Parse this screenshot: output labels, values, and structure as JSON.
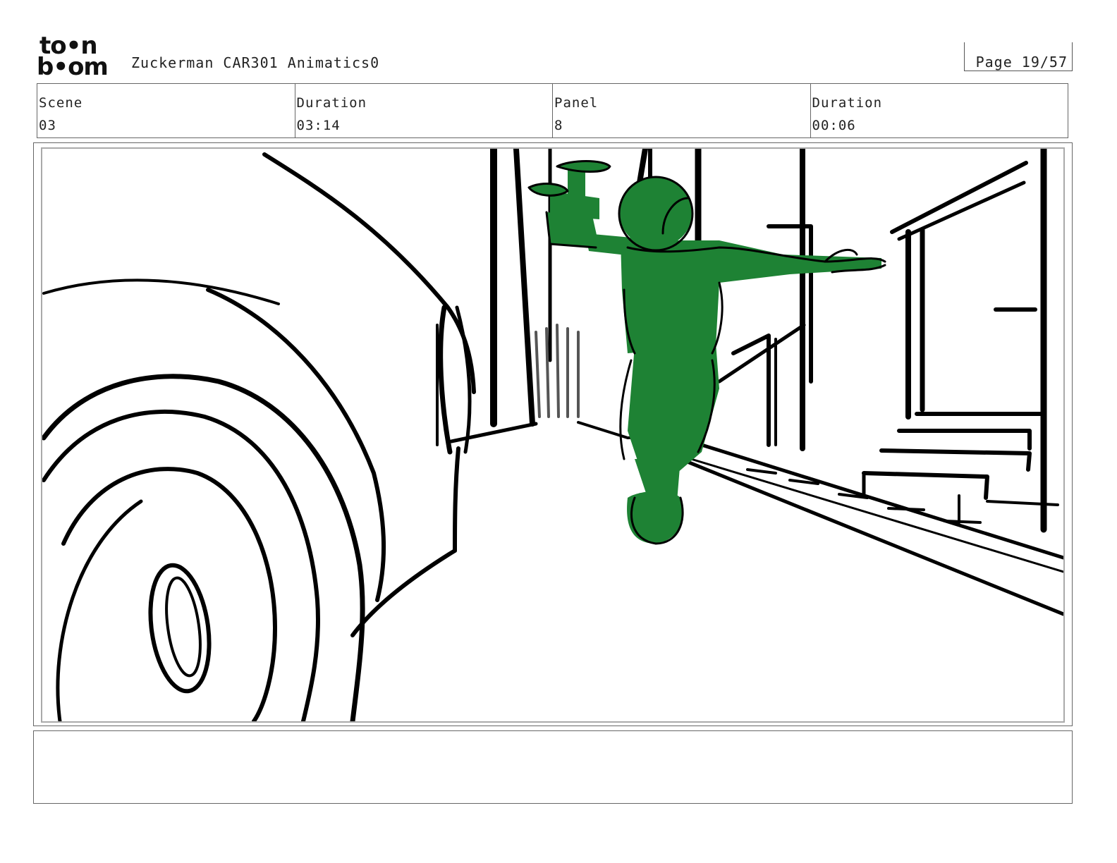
{
  "logo": {
    "line1": "to•n",
    "line2": "b•om",
    "brand": "toon boom"
  },
  "header": {
    "title": "Zuckerman CAR301 Animatics0",
    "page": "Page 19/57"
  },
  "info": {
    "scene_label": "Scene",
    "scene_value": "03",
    "scene_duration_label": "Duration",
    "scene_duration_value": "03:14",
    "panel_label": "Panel",
    "panel_value": "8",
    "panel_duration_label": "Duration",
    "panel_duration_value": "00:06"
  },
  "panel": {
    "character_color": "#1e8234",
    "line_color": "#000000"
  },
  "notes": {
    "text": ""
  }
}
